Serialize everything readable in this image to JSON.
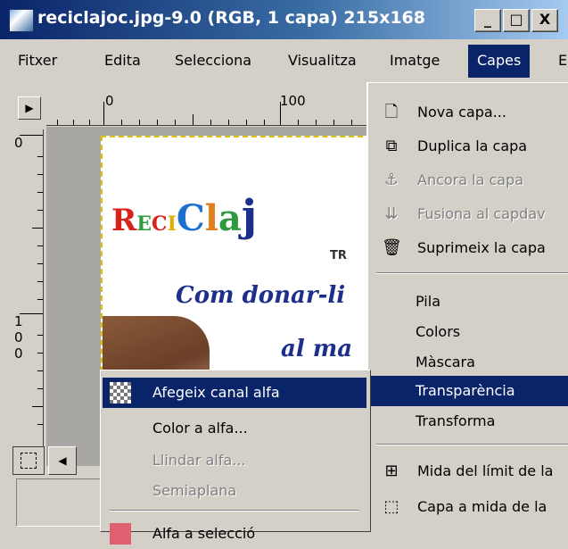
{
  "window": {
    "title": "reciclajoc.jpg-9.0 (RGB, 1 capa) 215x168",
    "minimize": "_",
    "maximize": "□",
    "close": "X"
  },
  "menubar": {
    "items": [
      "Fitxer",
      "Edita",
      "Selecciona",
      "Visualitza",
      "Imatge",
      "Capes"
    ],
    "overflow": "E"
  },
  "rulers": {
    "h_zero": "0",
    "h_hundred": "100",
    "v_zero": "0",
    "v_hundred": [
      "1",
      "0",
      "0"
    ]
  },
  "image": {
    "logo": [
      "R",
      "E",
      "C",
      "I",
      "C",
      "l",
      "a",
      "j"
    ],
    "logo_colors": [
      "#d8231d",
      "#2d9b3d",
      "#d8231d",
      "#e0b000",
      "#1d6fd0",
      "#e08020",
      "#2d9b3d",
      "#1d2f8a"
    ],
    "small_text": "TR",
    "script_line1": "Com donar-li",
    "script_line2": "al ma"
  },
  "capes_menu": {
    "items": [
      {
        "label": "Nova capa...",
        "icon": "new-layer-icon",
        "glyph": "🗋",
        "disabled": false
      },
      {
        "label": "Duplica la capa",
        "icon": "duplicate-icon",
        "glyph": "⧉",
        "disabled": false
      },
      {
        "label": "Ancora la capa",
        "icon": "anchor-icon",
        "glyph": "⚓",
        "disabled": true
      },
      {
        "label": "Fusiona al capdav",
        "icon": "merge-down-icon",
        "glyph": "⇊",
        "disabled": true
      },
      {
        "label": "Suprimeix la capa",
        "icon": "trash-icon",
        "glyph": "🗑",
        "disabled": false
      },
      {
        "label": "Pila",
        "disabled": false
      },
      {
        "label": "Colors",
        "disabled": false
      },
      {
        "label": "Màscara",
        "disabled": false
      },
      {
        "label": "Transparència",
        "disabled": false,
        "highlight": true
      },
      {
        "label": "Transforma",
        "disabled": false
      },
      {
        "label": "Mida del límit de la",
        "icon": "layer-boundary-icon",
        "glyph": "⊞",
        "disabled": false
      },
      {
        "label": "Capa a mida de la",
        "icon": "layer-to-image-size-icon",
        "glyph": "⬚",
        "disabled": false
      }
    ]
  },
  "transparency_menu": {
    "items": [
      {
        "label": "Afegeix canal alfa",
        "highlight": true,
        "icon": "add-alpha-icon"
      },
      {
        "label": "Color a alfa...",
        "disabled": false
      },
      {
        "label": "Llindar alfa...",
        "disabled": true
      },
      {
        "label": "Semiaplana",
        "disabled": true
      },
      {
        "label": "Alfa a selecció",
        "icon": "alpha-to-selection-icon"
      }
    ]
  },
  "colors": {
    "highlight": "#0a246a",
    "menu_bg": "#d4d0c8",
    "selection_border": "#e0c000"
  }
}
